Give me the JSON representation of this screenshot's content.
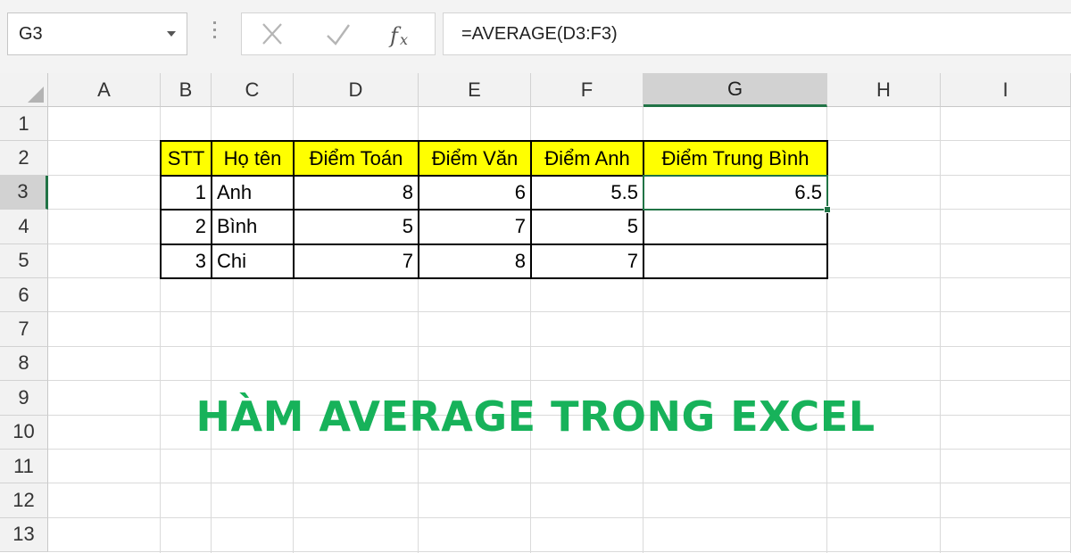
{
  "formula_bar": {
    "name_box": "G3",
    "formula": "=AVERAGE(D3:F3)"
  },
  "columns": [
    "A",
    "B",
    "C",
    "D",
    "E",
    "F",
    "G",
    "H",
    "I"
  ],
  "rows": [
    "1",
    "2",
    "3",
    "4",
    "5",
    "6",
    "7",
    "8",
    "9",
    "10",
    "11",
    "12",
    "13"
  ],
  "selection": {
    "column": "G",
    "row": "3"
  },
  "table": {
    "headers": [
      "STT",
      "Họ tên",
      "Điểm Toán",
      "Điểm Văn",
      "Điểm Anh",
      "Điểm Trung Bình"
    ],
    "rows": [
      [
        "1",
        "Anh",
        "8",
        "6",
        "5.5",
        "6.5"
      ],
      [
        "2",
        "Bình",
        "5",
        "7",
        "5",
        ""
      ],
      [
        "3",
        "Chi",
        "7",
        "8",
        "7",
        ""
      ]
    ]
  },
  "banner": "HÀM AVERAGE TRONG EXCEL",
  "colors": {
    "header_fill": "#ffff00",
    "selection_green": "#217346",
    "banner_green": "#17b25a"
  },
  "icons": [
    "dropdown-arrow-icon",
    "cancel-x-icon",
    "enter-check-icon",
    "fx-icon",
    "select-all-icon"
  ]
}
